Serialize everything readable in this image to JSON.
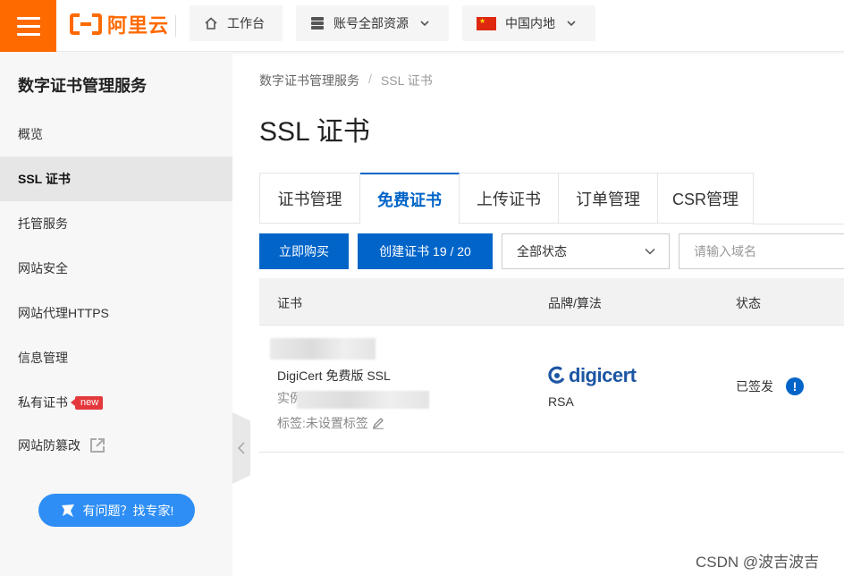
{
  "topbar": {
    "brand_name": "阿里云",
    "workbench_label": "工作台",
    "resources_label": "账号全部资源",
    "region_label": "中国内地",
    "accent_color": "#ff6a00"
  },
  "sidebar": {
    "title": "数字证书管理服务",
    "items": [
      {
        "label": "概览"
      },
      {
        "label": "SSL 证书"
      },
      {
        "label": "托管服务"
      },
      {
        "label": "网站安全"
      },
      {
        "label": "网站代理HTTPS"
      },
      {
        "label": "信息管理"
      },
      {
        "label": "私有证书",
        "badge": "new"
      },
      {
        "label": "网站防篡改"
      }
    ],
    "help_label": "有问题？找专家!"
  },
  "breadcrumb": {
    "parent": "数字证书管理服务",
    "separator": "/",
    "current": "SSL 证书"
  },
  "page": {
    "title": "SSL 证书"
  },
  "tabs": [
    {
      "label": "证书管理"
    },
    {
      "label": "免费证书"
    },
    {
      "label": "上传证书"
    },
    {
      "label": "订单管理"
    },
    {
      "label": "CSR管理"
    }
  ],
  "toolbar": {
    "buy_label": "立即购买",
    "create_label": "创建证书 19 / 20",
    "status_select": "全部状态",
    "domain_placeholder": "请输入域名"
  },
  "table": {
    "columns": [
      "证书",
      "品牌/算法",
      "状态"
    ],
    "rows": [
      {
        "name": "DigiCert 免费版 SSL",
        "instance_label": "实例:",
        "tags_label": "标签:未设置标签",
        "brand": "digicert",
        "algorithm": "RSA",
        "status": "已签发"
      }
    ]
  },
  "watermark": "CSDN @波吉波吉",
  "colors": {
    "primary": "#0064c8",
    "help_button": "#2e8ef5",
    "new_badge": "#e4393c",
    "digicert_blue": "#1d56a3"
  }
}
